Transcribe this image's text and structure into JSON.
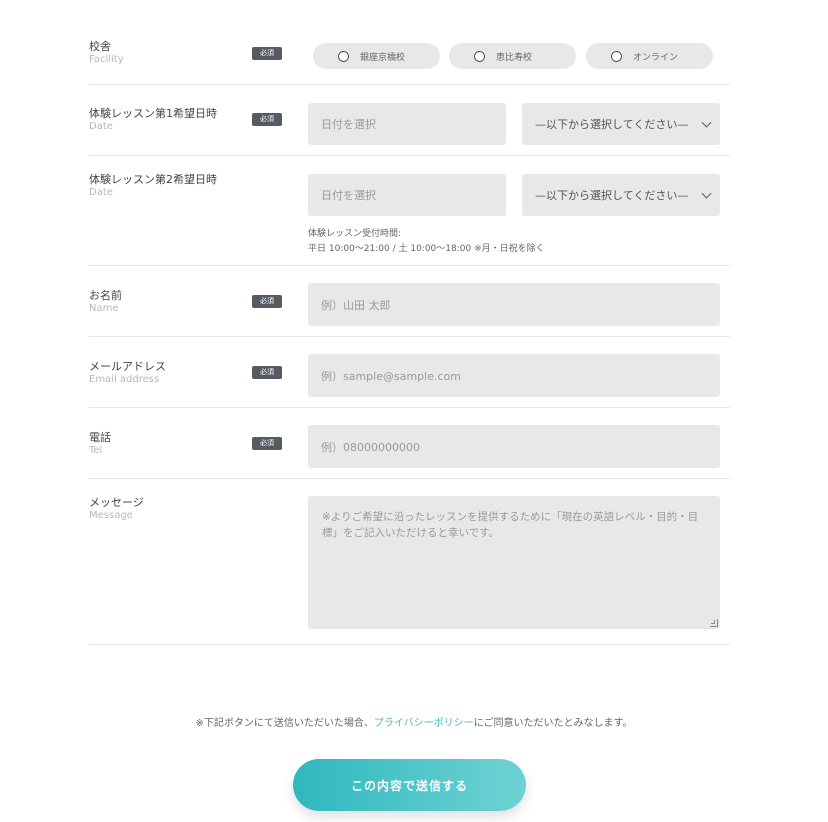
{
  "form": {
    "required_badge": "必須",
    "facility": {
      "label": "校舎",
      "label_en": "Facility",
      "options": [
        "銀座京橋校",
        "恵比寿校",
        "オンライン"
      ]
    },
    "date1": {
      "label": "体験レッスン第1希望日時",
      "label_en": "Date",
      "date_placeholder": "日付を選択",
      "time_select": "—以下から選択してください—"
    },
    "date2": {
      "label": "体験レッスン第2希望日時",
      "label_en": "Date",
      "date_placeholder": "日付を選択",
      "time_select": "—以下から選択してください—",
      "note_title": "体験レッスン受付時間:",
      "note_hours": "平日 10:00〜21:00 / 土 10:00〜18:00 ※月・日祝を除く"
    },
    "name": {
      "label": "お名前",
      "label_en": "Name",
      "placeholder": "例）山田 太郎"
    },
    "email": {
      "label": "メールアドレス",
      "label_en": "Email address",
      "placeholder": "例）sample@sample.com"
    },
    "tel": {
      "label": "電話",
      "label_en": "Tel",
      "placeholder": "例）08000000000"
    },
    "message": {
      "label": "メッセージ",
      "label_en": "Message",
      "placeholder": "※よりご希望に沿ったレッスンを提供するために「現在の英語レベル・目的・目標」をご記入いただけると幸いです。"
    }
  },
  "consent": {
    "prefix": "※下記ボタンにて送信いただいた場合、",
    "link": "プライバシーポリシー",
    "suffix": "にご同意いただいたとみなします。"
  },
  "submit_label": "この内容で送信する"
}
